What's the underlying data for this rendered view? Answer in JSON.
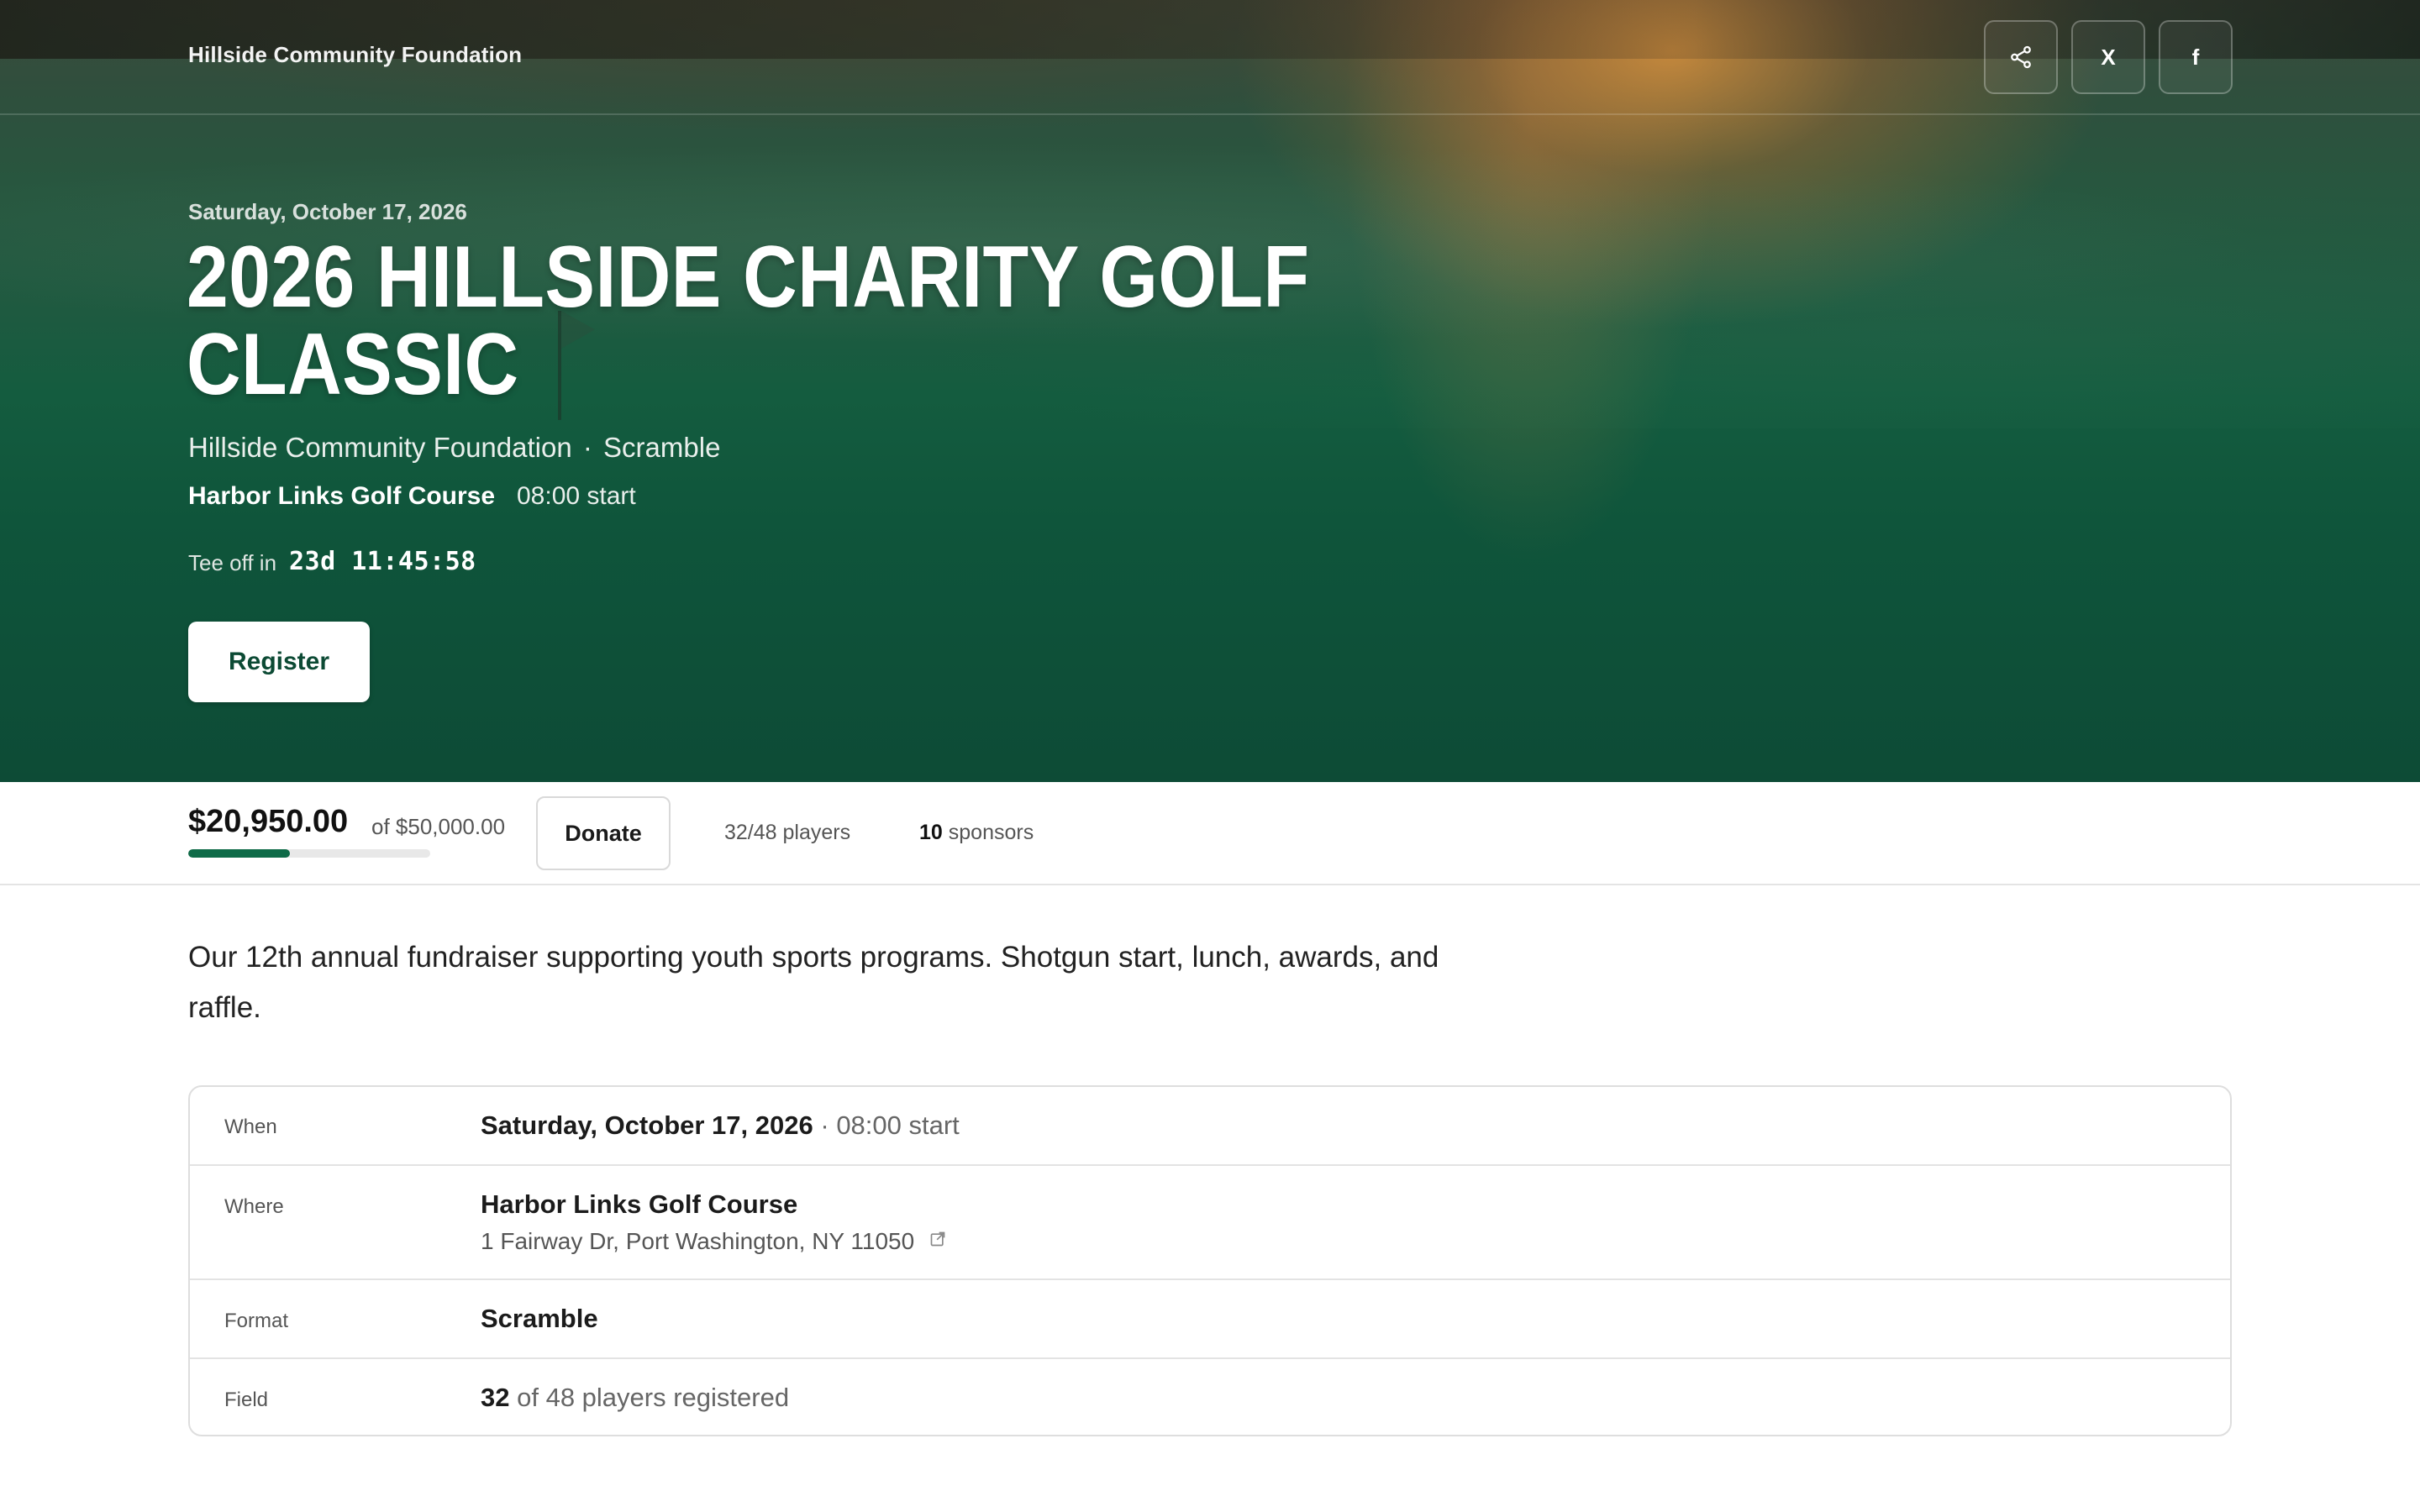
{
  "header": {
    "org_name": "Hillside Community Foundation",
    "share_icon": "share-icon",
    "x_label": "X",
    "facebook_label": "f"
  },
  "hero": {
    "date": "Saturday, October 17, 2026",
    "title_line1": "2026 HILLSIDE CHARITY GOLF",
    "title_line2": "CLASSIC",
    "org": "Hillside Community Foundation",
    "separator": "·",
    "format": "Scramble",
    "venue": "Harbor Links Golf Course",
    "start_time": "08:00 start",
    "countdown_label": "Tee off in",
    "countdown_value": "23d 11:45:58",
    "register_label": "Register"
  },
  "stats": {
    "raised": "$20,950.00",
    "goal": "of $50,000.00",
    "progress_fraction": 0.419,
    "donate_label": "Donate",
    "players": "32/48 players",
    "sponsors_count": "10",
    "sponsors_label": "sponsors"
  },
  "description": "Our 12th annual fundraiser supporting youth sports programs. Shotgun start, lunch, awards, and raffle.",
  "details": {
    "when_label": "When",
    "when_date": "Saturday, October 17, 2026",
    "when_sep": "·",
    "when_time": "08:00 start",
    "where_label": "Where",
    "where_name": "Harbor Links Golf Course",
    "where_address": "1 Fairway Dr, Port Washington, NY 11050",
    "format_label": "Format",
    "format_value": "Scramble",
    "field_label": "Field",
    "field_count": "32",
    "field_text": "of 48 players registered"
  },
  "colors": {
    "brand_green": "#0c4a34",
    "progress_green": "#0f6b48"
  }
}
